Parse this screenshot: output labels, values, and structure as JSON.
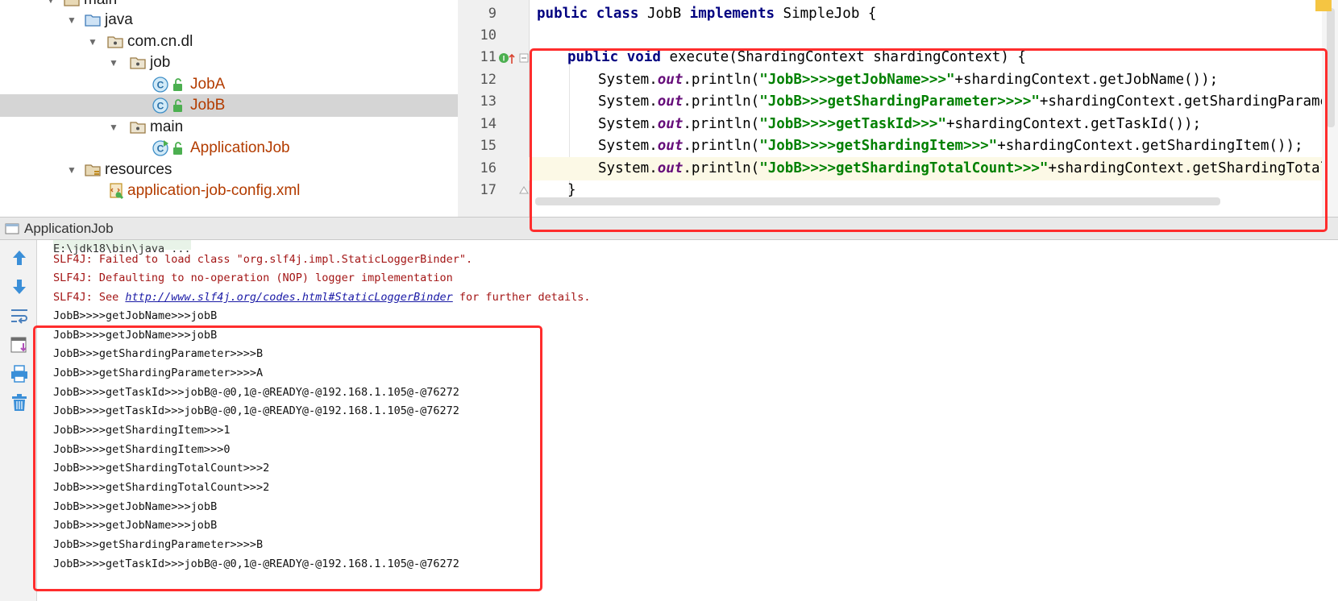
{
  "tree": {
    "items": [
      {
        "label": "main",
        "kind": "folder"
      },
      {
        "label": "java",
        "kind": "source-folder"
      },
      {
        "label": "com.cn.dl",
        "kind": "package"
      },
      {
        "label": "job",
        "kind": "package"
      },
      {
        "label": "JobA",
        "kind": "class"
      },
      {
        "label": "JobB",
        "kind": "class"
      },
      {
        "label": "main",
        "kind": "package"
      },
      {
        "label": "ApplicationJob",
        "kind": "class-main"
      },
      {
        "label": "resources",
        "kind": "resources-folder"
      },
      {
        "label": "application-job-config.xml",
        "kind": "xml-file"
      }
    ]
  },
  "editor": {
    "line_numbers": [
      "9",
      "10",
      "11",
      "12",
      "13",
      "14",
      "15",
      "16",
      "17"
    ],
    "lines": {
      "l9": {
        "kw1": "public class",
        "name": " JobB ",
        "kw2": "implements",
        "rest": " SimpleJob {"
      },
      "l11": {
        "kw": "public void",
        "rest": " execute(ShardingContext shardingContext) {"
      },
      "l12": {
        "pre": "System.",
        "fld": "out",
        "mid": ".println(",
        "str": "\"JobB>>>>getJobName>>>\"",
        "rest": "+shardingContext.getJobName());"
      },
      "l13": {
        "pre": "System.",
        "fld": "out",
        "mid": ".println(",
        "str": "\"JobB>>>getShardingParameter>>>>\"",
        "rest": "+shardingContext.getShardingParamet"
      },
      "l14": {
        "pre": "System.",
        "fld": "out",
        "mid": ".println(",
        "str": "\"JobB>>>>getTaskId>>>\"",
        "rest": "+shardingContext.getTaskId());"
      },
      "l15": {
        "pre": "System.",
        "fld": "out",
        "mid": ".println(",
        "str": "\"JobB>>>>getShardingItem>>>\"",
        "rest": "+shardingContext.getShardingItem());"
      },
      "l16": {
        "pre": "System.",
        "fld": "out",
        "mid": ".println(",
        "str": "\"JobB>>>>getShardingTotalCount>>>\"",
        "rest": "+shardingContext.getShardingTotalC"
      },
      "l17": {
        "rest": "}"
      }
    }
  },
  "run": {
    "title": "ApplicationJob",
    "console": {
      "cmd": "E:\\jdk18\\bin\\java ...",
      "slf1": "SLF4J: Failed to load class \"org.slf4j.impl.StaticLoggerBinder\".",
      "slf2": "SLF4J: Defaulting to no-operation (NOP) logger implementation",
      "slf3_pre": "SLF4J: See ",
      "slf3_link": "http://www.slf4j.org/codes.html#StaticLoggerBinder",
      "slf3_post": " for further details.",
      "output": [
        "JobB>>>>getJobName>>>jobB",
        "JobB>>>>getJobName>>>jobB",
        "JobB>>>getShardingParameter>>>>B",
        "JobB>>>getShardingParameter>>>>A",
        "JobB>>>>getTaskId>>>jobB@-@0,1@-@READY@-@192.168.1.105@-@76272",
        "JobB>>>>getTaskId>>>jobB@-@0,1@-@READY@-@192.168.1.105@-@76272",
        "JobB>>>>getShardingItem>>>1",
        "JobB>>>>getShardingItem>>>0",
        "JobB>>>>getShardingTotalCount>>>2",
        "JobB>>>>getShardingTotalCount>>>2",
        "JobB>>>>getJobName>>>jobB",
        "JobB>>>>getJobName>>>jobB",
        "JobB>>>getShardingParameter>>>>B",
        "JobB>>>>getTaskId>>>jobB@-@0,1@-@READY@-@192.168.1.105@-@76272"
      ]
    },
    "toolbar_icons": [
      "up-arrow-icon",
      "down-arrow-icon",
      "soft-wrap-icon",
      "scroll-to-end-icon",
      "print-icon",
      "trash-icon"
    ]
  },
  "colors": {
    "highlight": "#ff2d2d",
    "keyword": "#000080",
    "string": "#008000",
    "field": "#660e7a",
    "class_name": "#b33c00",
    "error_text": "#a31515",
    "link": "#1a1aa6"
  }
}
